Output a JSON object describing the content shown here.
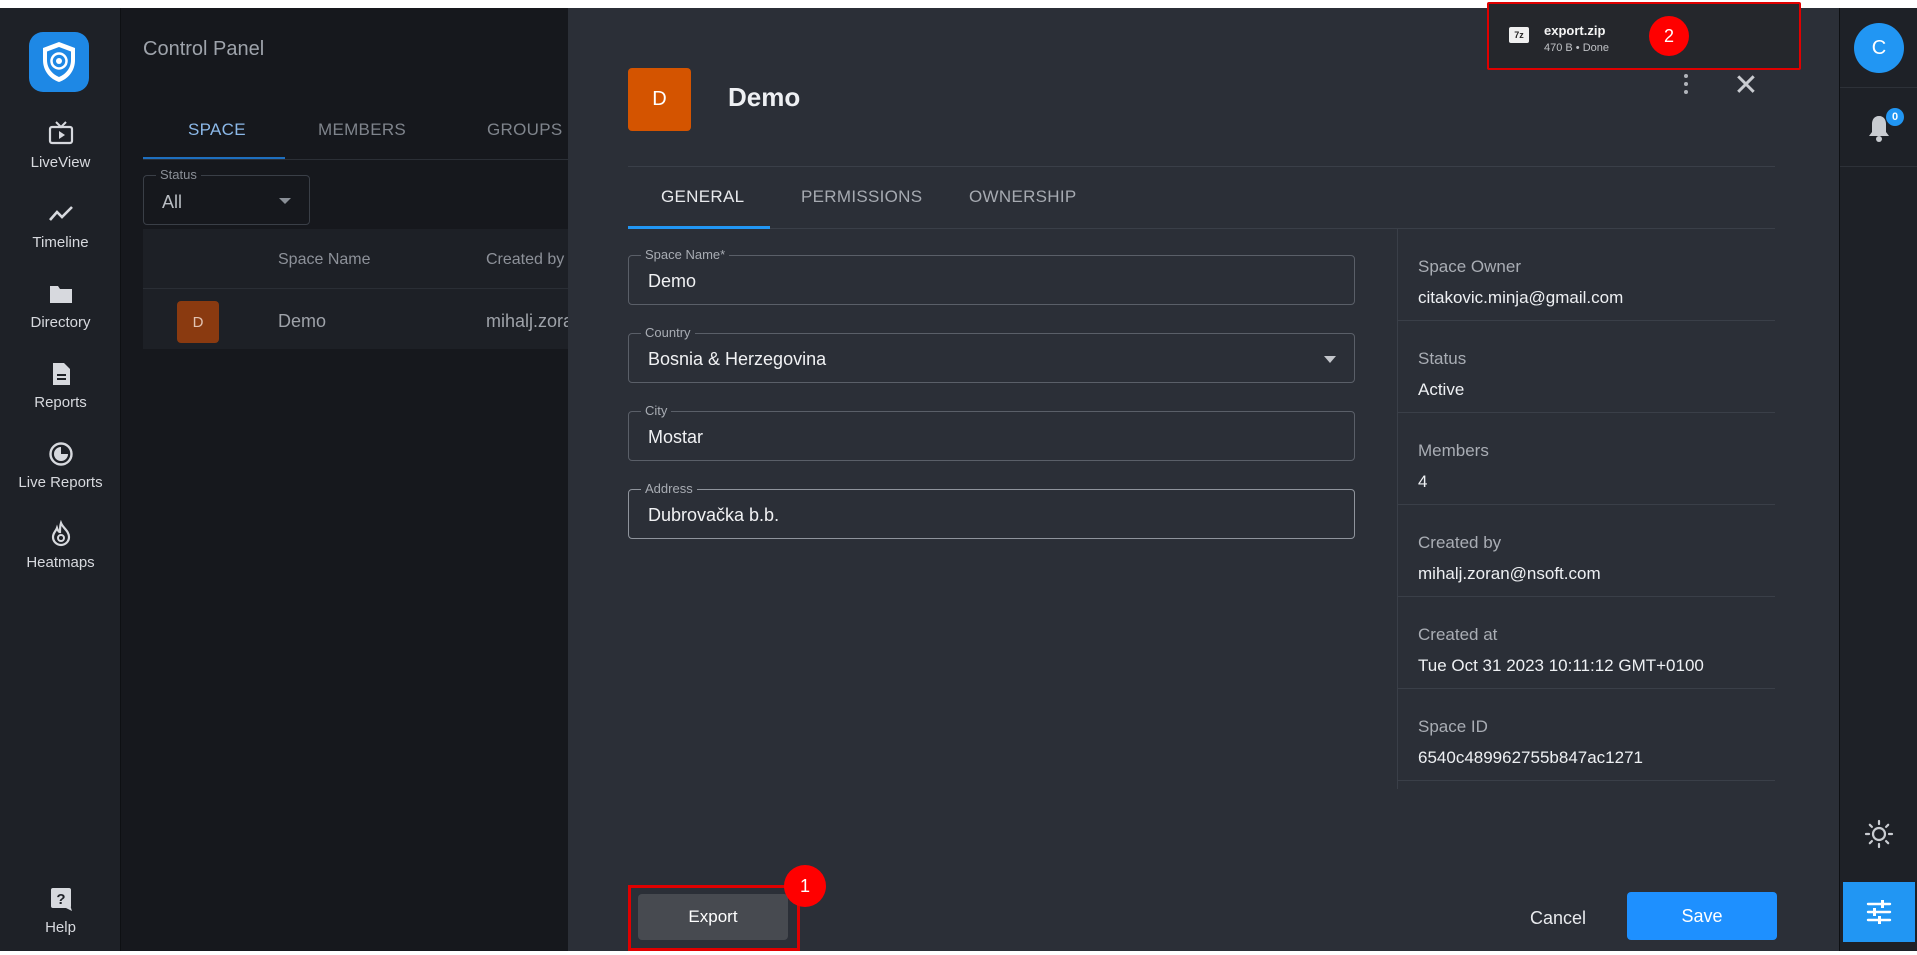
{
  "sidebar": {
    "items": [
      {
        "label": "LiveView",
        "icon": "tv-icon"
      },
      {
        "label": "Timeline",
        "icon": "trend-icon"
      },
      {
        "label": "Directory",
        "icon": "folder-icon"
      },
      {
        "label": "Reports",
        "icon": "document-icon"
      },
      {
        "label": "Live Reports",
        "icon": "pie-icon"
      },
      {
        "label": "Heatmaps",
        "icon": "flame-icon"
      }
    ],
    "help_label": "Help"
  },
  "control_panel": {
    "title": "Control Panel",
    "tabs": [
      "SPACE",
      "MEMBERS",
      "GROUPS"
    ],
    "status_filter": {
      "legend": "Status",
      "value": "All"
    },
    "table": {
      "headers": [
        "Space Name",
        "Created by"
      ],
      "rows": [
        {
          "avatar": "D",
          "name": "Demo",
          "created_by": "mihalj.zora"
        }
      ]
    }
  },
  "modal": {
    "avatar_letter": "D",
    "title": "Demo",
    "tabs": [
      "GENERAL",
      "PERMISSIONS",
      "OWNERSHIP"
    ],
    "fields": {
      "space_name": {
        "label": "Space Name*",
        "value": "Demo"
      },
      "country": {
        "label": "Country",
        "value": "Bosnia & Herzegovina"
      },
      "city": {
        "label": "City",
        "value": "Mostar"
      },
      "address": {
        "label": "Address",
        "value": "Dubrovačka b.b."
      }
    },
    "info": [
      {
        "key": "Space Owner",
        "value": "citakovic.minja@gmail.com"
      },
      {
        "key": "Status",
        "value": "Active"
      },
      {
        "key": "Members",
        "value": "4"
      },
      {
        "key": "Created by",
        "value": "mihalj.zoran@nsoft.com"
      },
      {
        "key": "Created at",
        "value": "Tue Oct 31 2023 10:11:12 GMT+0100"
      },
      {
        "key": "Space ID",
        "value": "6540c489962755b847ac1271"
      }
    ],
    "buttons": {
      "export": "Export",
      "cancel": "Cancel",
      "save": "Save"
    }
  },
  "right_rail": {
    "user_initial": "C",
    "notification_count": "0"
  },
  "download": {
    "icon_text": "7z",
    "filename": "export.zip",
    "meta": "470 B • Done"
  },
  "annotations": {
    "marker_1": "1",
    "marker_2": "2"
  },
  "colors": {
    "accent": "#2196f3",
    "avatar_orange": "#d45400",
    "annotation_red": "#ff0000"
  }
}
